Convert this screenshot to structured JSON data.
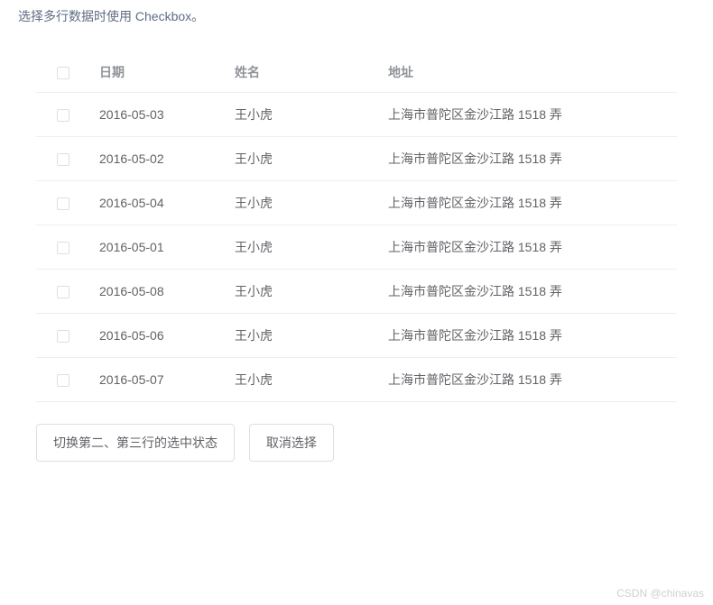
{
  "description": "选择多行数据时使用 Checkbox。",
  "table": {
    "headers": {
      "date": "日期",
      "name": "姓名",
      "address": "地址"
    },
    "rows": [
      {
        "date": "2016-05-03",
        "name": "王小虎",
        "address": "上海市普陀区金沙江路 1518 弄"
      },
      {
        "date": "2016-05-02",
        "name": "王小虎",
        "address": "上海市普陀区金沙江路 1518 弄"
      },
      {
        "date": "2016-05-04",
        "name": "王小虎",
        "address": "上海市普陀区金沙江路 1518 弄"
      },
      {
        "date": "2016-05-01",
        "name": "王小虎",
        "address": "上海市普陀区金沙江路 1518 弄"
      },
      {
        "date": "2016-05-08",
        "name": "王小虎",
        "address": "上海市普陀区金沙江路 1518 弄"
      },
      {
        "date": "2016-05-06",
        "name": "王小虎",
        "address": "上海市普陀区金沙江路 1518 弄"
      },
      {
        "date": "2016-05-07",
        "name": "王小虎",
        "address": "上海市普陀区金沙江路 1518 弄"
      }
    ]
  },
  "buttons": {
    "toggle": "切换第二、第三行的选中状态",
    "cancel": "取消选择"
  },
  "watermark": "CSDN @chinavas"
}
